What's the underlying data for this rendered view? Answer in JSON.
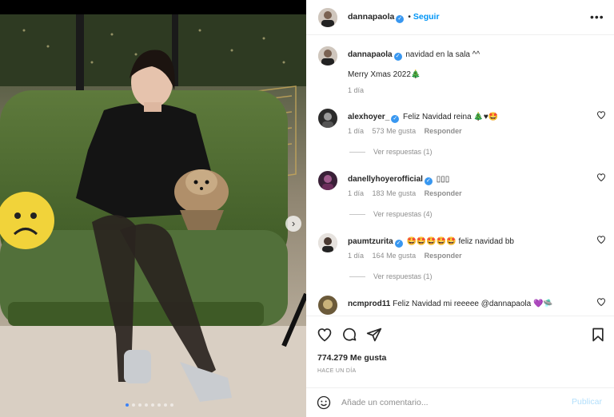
{
  "post": {
    "author": "dannapaola",
    "follow_label": "Seguir",
    "more_icon": "more-horizontal-icon",
    "caption_text": "navidad en la sala ^^",
    "caption_line2": "Merry Xmas 2022🎄",
    "caption_time": "1 día",
    "likes": "774.279 Me gusta",
    "posted": "HACE UN DÍA",
    "carousel_total": 8,
    "carousel_index": 0
  },
  "comments": [
    {
      "user": "alexhoyer_",
      "verified": true,
      "text": "Feliz Navidad reina 🎄♥🤩",
      "time": "1 día",
      "likes": "573 Me gusta",
      "reply_label": "Responder",
      "replies": "Ver respuestas (1)"
    },
    {
      "user": "danellyhoyerofficial",
      "verified": true,
      "text": "▯▯▯",
      "time": "1 día",
      "likes": "183 Me gusta",
      "reply_label": "Responder",
      "replies": "Ver respuestas (4)"
    },
    {
      "user": "paumtzurita",
      "verified": true,
      "text": "🤩🤩🤩🤩🤩 feliz navidad bb",
      "time": "1 día",
      "likes": "164 Me gusta",
      "reply_label": "Responder",
      "replies": "Ver respuestas (1)"
    },
    {
      "user": "ncmprod11",
      "verified": false,
      "text": "Feliz Navidad mi reeeee @dannapaola 💜🛸"
    }
  ],
  "composer": {
    "placeholder": "Añade un comentario...",
    "post_label": "Publicar"
  },
  "colors": {
    "accent": "#0095f6",
    "verified": "#3897f0",
    "muted": "#8e8e8e"
  }
}
